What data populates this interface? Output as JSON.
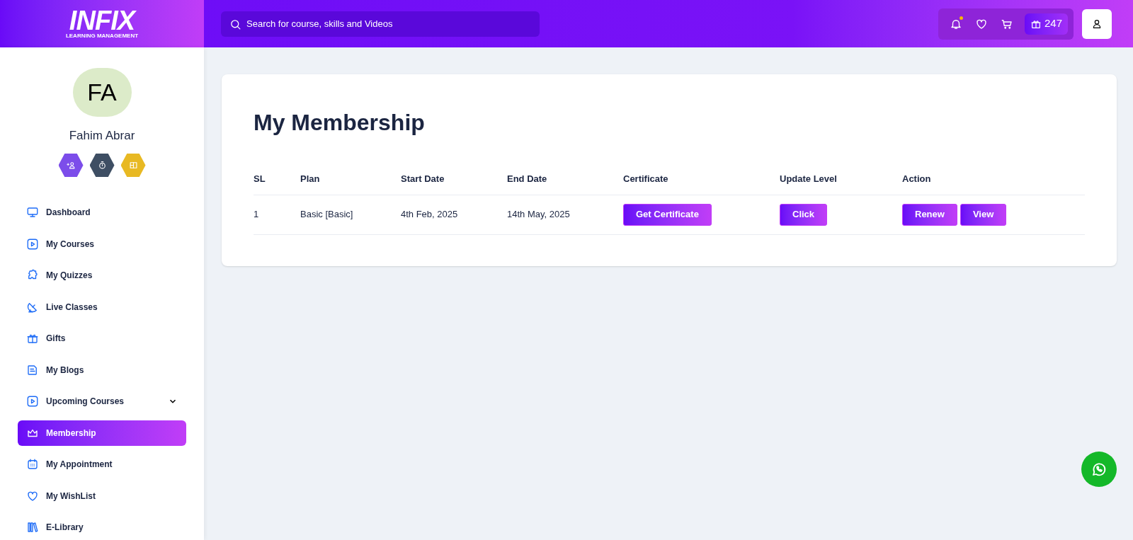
{
  "logo": {
    "title": "INFIX",
    "subtitle": "LEARNING MANAGEMENT"
  },
  "search": {
    "placeholder": "Search for course, skills and Videos"
  },
  "header": {
    "notification_dot": true,
    "points": "247"
  },
  "profile": {
    "initials": "FA",
    "name": "Fahim Abrar"
  },
  "badges": [
    {
      "kind": "people",
      "color": "#7c4dea"
    },
    {
      "kind": "timer",
      "color": "#3e4e63"
    },
    {
      "kind": "board",
      "color": "#e8b923"
    }
  ],
  "sidebar": {
    "items": [
      {
        "label": "Dashboard",
        "kind": "monitor",
        "selected": false
      },
      {
        "label": "My Courses",
        "kind": "play",
        "selected": false
      },
      {
        "label": "My Quizzes",
        "kind": "puzzle",
        "selected": false
      },
      {
        "label": "Live Classes",
        "kind": "satellite",
        "selected": false
      },
      {
        "label": "Gifts",
        "kind": "gift",
        "selected": false
      },
      {
        "label": "My Blogs",
        "kind": "note",
        "selected": false
      },
      {
        "label": "Upcoming Courses",
        "kind": "play",
        "selected": false,
        "expanded": false
      },
      {
        "label": "Membership",
        "kind": "crown",
        "selected": true
      },
      {
        "label": "My Appointment",
        "kind": "calendar",
        "selected": false
      },
      {
        "label": "My WishList",
        "kind": "heart",
        "selected": false
      },
      {
        "label": "E-Library",
        "kind": "books",
        "selected": false
      }
    ]
  },
  "page": {
    "title": "My Membership"
  },
  "table": {
    "columns": [
      "SL",
      "Plan",
      "Start Date",
      "End Date",
      "Certificate",
      "Update Level",
      "Action"
    ],
    "rows": [
      {
        "sl": "1",
        "plan": "Basic [Basic]",
        "start": "4th Feb, 2025",
        "end": "14th May, 2025",
        "certificate": "Get Certificate",
        "update": "Click",
        "actions": [
          "Renew",
          "View"
        ]
      }
    ]
  }
}
